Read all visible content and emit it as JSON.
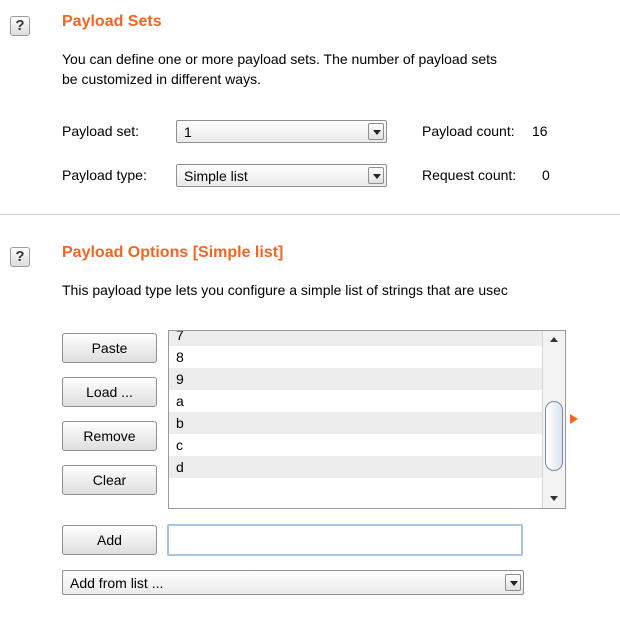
{
  "payload_sets": {
    "title": "Payload Sets",
    "description_line1": "You can define one or more payload sets. The number of payload sets",
    "description_line2": "be customized in different ways.",
    "set_label": "Payload set:",
    "set_value": "1",
    "count_label": "Payload count:",
    "count_value": "16",
    "type_label": "Payload type:",
    "type_value": "Simple list",
    "request_label": "Request count:",
    "request_value": "0"
  },
  "payload_options": {
    "title": "Payload Options [Simple list]",
    "description": "This payload type lets you configure a simple list of strings that are usec",
    "buttons": {
      "paste": "Paste",
      "load": "Load ...",
      "remove": "Remove",
      "clear": "Clear",
      "add": "Add"
    },
    "list_items": [
      "7",
      "8",
      "9",
      "a",
      "b",
      "c",
      "d"
    ],
    "add_input_value": "",
    "add_from_list": "Add from list ..."
  },
  "help_glyph": "?",
  "accent_color": "#f26522",
  "icons": [
    "help-icon",
    "dropdown-arrow-icon",
    "scroll-up-icon",
    "scroll-down-icon",
    "expand-arrow-icon"
  ]
}
